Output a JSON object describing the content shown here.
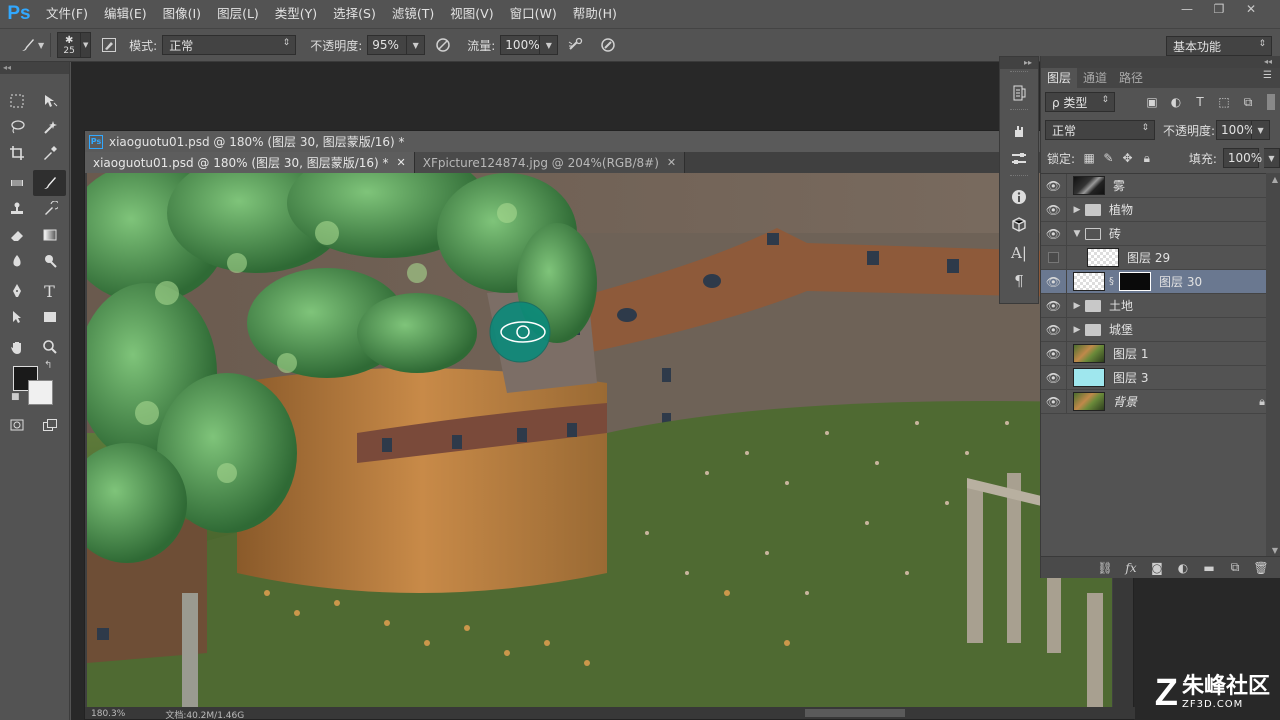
{
  "app": {
    "logo": "Ps"
  },
  "menu": [
    "文件(F)",
    "编辑(E)",
    "图像(I)",
    "图层(L)",
    "类型(Y)",
    "选择(S)",
    "滤镜(T)",
    "视图(V)",
    "窗口(W)",
    "帮助(H)"
  ],
  "window_controls": {
    "minimize": "—",
    "restore": "❐",
    "close": "✕"
  },
  "options": {
    "brush_size": "25",
    "mode_label": "模式:",
    "mode_value": "正常",
    "opacity_label": "不透明度:",
    "opacity_value": "95%",
    "flow_label": "流量:",
    "flow_value": "100%",
    "workspace": "基本功能"
  },
  "document": {
    "window_title": "xiaoguotu01.psd @ 180% (图层 30, 图层蒙版/16) *",
    "tabs": [
      {
        "label": "xiaoguotu01.psd @ 180% (图层 30, 图层蒙版/16) *",
        "close": "✕"
      },
      {
        "label": "XFpicture124874.jpg @ 204%(RGB/8#)",
        "close": "✕"
      }
    ],
    "status_zoom": "180.3%",
    "status_doc": "文档:40.2M/1.46G"
  },
  "layers_panel": {
    "tabs": [
      "图层",
      "通道",
      "路径"
    ],
    "filter_label": "ρ 类型",
    "blend_mode": "正常",
    "opacity_label": "不透明度:",
    "opacity_value": "100%",
    "lock_label": "锁定:",
    "fill_label": "填充:",
    "fill_value": "100%",
    "layers": [
      {
        "name": "雾",
        "type": "layer",
        "thumb": "dark",
        "visible": true
      },
      {
        "name": "植物",
        "type": "group",
        "expanded": false,
        "visible": true
      },
      {
        "name": "砖",
        "type": "group",
        "expanded": true,
        "visible": true
      },
      {
        "name": "图层 29",
        "type": "layer",
        "thumb": "checker",
        "visible": false,
        "indent": true
      },
      {
        "name": "图层 30",
        "type": "layer-mask",
        "thumb": "checker",
        "visible": true,
        "selected": true
      },
      {
        "name": "土地",
        "type": "group",
        "expanded": false,
        "visible": true
      },
      {
        "name": "城堡",
        "type": "group",
        "expanded": false,
        "visible": true
      },
      {
        "name": "图层 1",
        "type": "layer",
        "thumb": "scene",
        "visible": true
      },
      {
        "name": "图层 3",
        "type": "layer",
        "thumb": "cyan",
        "visible": true
      },
      {
        "name": "背景",
        "type": "background",
        "thumb": "scene",
        "visible": true,
        "locked": true
      }
    ]
  },
  "watermark": {
    "logo": "Z",
    "title": "朱峰社区",
    "subtitle": "ZF3D.COM"
  },
  "colors": {
    "foreground": "#1a1a1a",
    "background": "#f0f0f0",
    "ps_blue": "#31a8ff",
    "selected_layer": "#6a7890"
  }
}
